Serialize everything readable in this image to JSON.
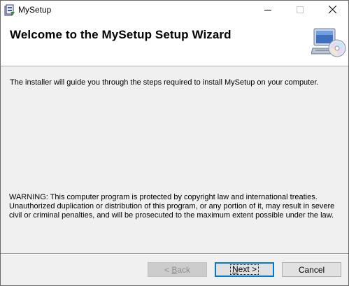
{
  "window": {
    "title": "MySetup",
    "controls": {
      "minimize_icon": "minimize-icon",
      "maximize_icon": "maximize-icon",
      "close_icon": "close-icon"
    }
  },
  "banner": {
    "title": "Welcome to the MySetup Setup Wizard",
    "image_icon": "computer-cd-icon"
  },
  "body": {
    "intro": "The installer will guide you through the steps required to install MySetup on your computer.",
    "warning": "WARNING: This computer program is protected by copyright law and international treaties. Unauthorized duplication or distribution of this program, or any portion of it, may result in severe civil or criminal penalties, and will be prosecuted to the maximum extent possible under the law."
  },
  "buttons": {
    "back": {
      "prefix": "< ",
      "mnemonic": "B",
      "rest": "ack",
      "enabled": false
    },
    "next": {
      "mnemonic": "N",
      "rest": "ext >",
      "focused": true
    },
    "cancel": {
      "label": "Cancel"
    }
  },
  "colors": {
    "focus_border": "#0078d7",
    "background": "#f0f0f0"
  }
}
